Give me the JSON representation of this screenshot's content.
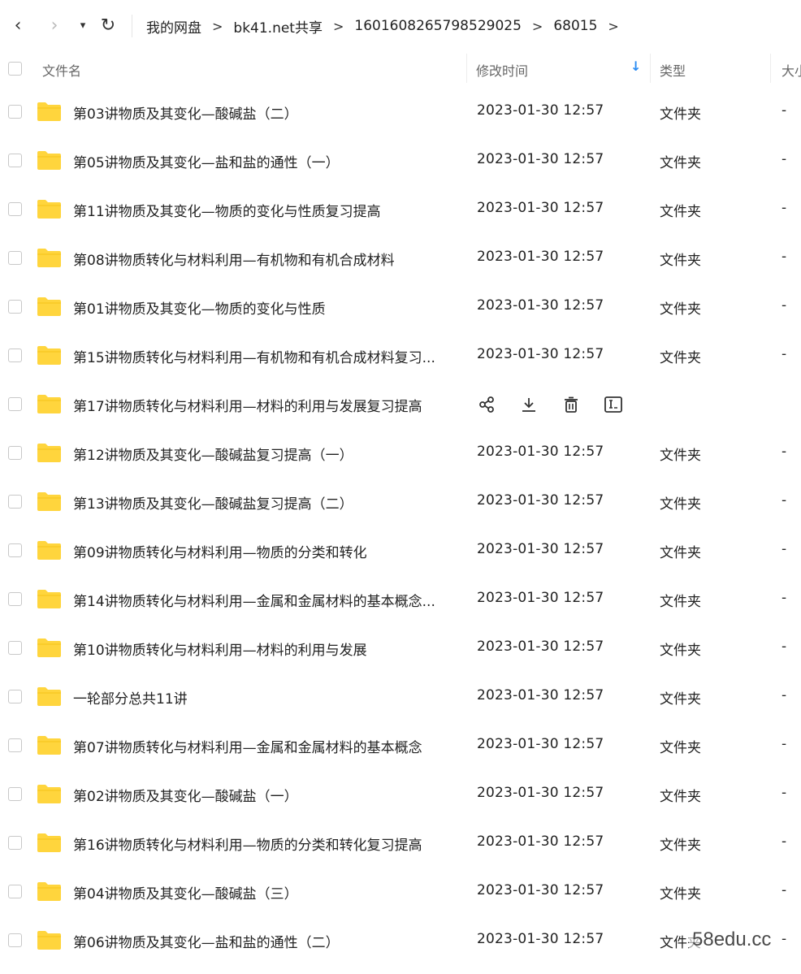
{
  "nav": {
    "back_icon": "‹",
    "forward_icon": "›",
    "history_icon": "▾",
    "refresh_icon": "↻"
  },
  "breadcrumb": {
    "items": [
      "我的网盘",
      "bk41.net共享",
      "1601608265798529025",
      "68015"
    ],
    "separator": ">"
  },
  "table": {
    "headers": {
      "name": "文件名",
      "mtime": "修改时间",
      "type": "类型",
      "size": "大小"
    },
    "sort_icon": "↓",
    "sort_color": "#2a8cf3",
    "folder_color": "#ffd53d",
    "rows": [
      {
        "name": "第03讲物质及其变化—酸碱盐（二）",
        "mtime": "2023-01-30 12:57",
        "type": "文件夹",
        "size": "-"
      },
      {
        "name": "第05讲物质及其变化—盐和盐的通性（一）",
        "mtime": "2023-01-30 12:57",
        "type": "文件夹",
        "size": "-"
      },
      {
        "name": "第11讲物质及其变化—物质的变化与性质复习提高",
        "mtime": "2023-01-30 12:57",
        "type": "文件夹",
        "size": "-"
      },
      {
        "name": "第08讲物质转化与材料利用—有机物和有机合成材料",
        "mtime": "2023-01-30 12:57",
        "type": "文件夹",
        "size": "-"
      },
      {
        "name": "第01讲物质及其变化—物质的变化与性质",
        "mtime": "2023-01-30 12:57",
        "type": "文件夹",
        "size": "-"
      },
      {
        "name": "第15讲物质转化与材料利用—有机物和有机合成材料复习...",
        "mtime": "2023-01-30 12:57",
        "type": "文件夹",
        "size": "-"
      },
      {
        "name": "第17讲物质转化与材料利用—材料的利用与发展复习提高",
        "hovered": true,
        "actions": [
          "share-icon",
          "download-icon",
          "delete-icon",
          "rename-icon"
        ]
      },
      {
        "name": "第12讲物质及其变化—酸碱盐复习提高（一）",
        "mtime": "2023-01-30 12:57",
        "type": "文件夹",
        "size": "-"
      },
      {
        "name": "第13讲物质及其变化—酸碱盐复习提高（二）",
        "mtime": "2023-01-30 12:57",
        "type": "文件夹",
        "size": "-"
      },
      {
        "name": "第09讲物质转化与材料利用—物质的分类和转化",
        "mtime": "2023-01-30 12:57",
        "type": "文件夹",
        "size": "-"
      },
      {
        "name": "第14讲物质转化与材料利用—金属和金属材料的基本概念...",
        "mtime": "2023-01-30 12:57",
        "type": "文件夹",
        "size": "-"
      },
      {
        "name": "第10讲物质转化与材料利用—材料的利用与发展",
        "mtime": "2023-01-30 12:57",
        "type": "文件夹",
        "size": "-"
      },
      {
        "name": "一轮部分总共11讲",
        "mtime": "2023-01-30 12:57",
        "type": "文件夹",
        "size": "-"
      },
      {
        "name": "第07讲物质转化与材料利用—金属和金属材料的基本概念",
        "mtime": "2023-01-30 12:57",
        "type": "文件夹",
        "size": "-"
      },
      {
        "name": "第02讲物质及其变化—酸碱盐（一）",
        "mtime": "2023-01-30 12:57",
        "type": "文件夹",
        "size": "-"
      },
      {
        "name": "第16讲物质转化与材料利用—物质的分类和转化复习提高",
        "mtime": "2023-01-30 12:57",
        "type": "文件夹",
        "size": "-"
      },
      {
        "name": "第04讲物质及其变化—酸碱盐（三）",
        "mtime": "2023-01-30 12:57",
        "type": "文件夹",
        "size": "-"
      },
      {
        "name": "第06讲物质及其变化—盐和盐的通性（二）",
        "mtime": "2023-01-30 12:57",
        "type": "文件夹",
        "size": "-"
      }
    ]
  },
  "watermark": "58edu.cc"
}
